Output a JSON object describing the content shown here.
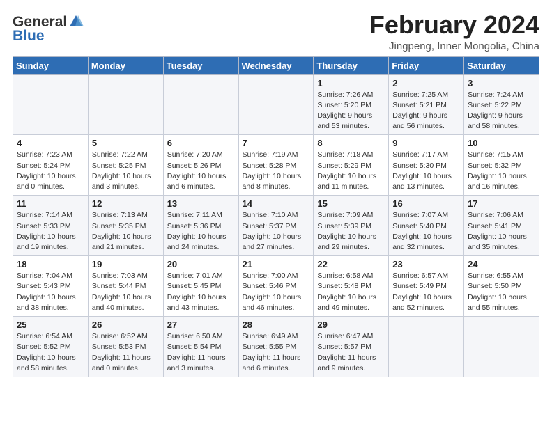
{
  "header": {
    "logo_general": "General",
    "logo_blue": "Blue",
    "month_title": "February 2024",
    "location": "Jingpeng, Inner Mongolia, China"
  },
  "weekdays": [
    "Sunday",
    "Monday",
    "Tuesday",
    "Wednesday",
    "Thursday",
    "Friday",
    "Saturday"
  ],
  "weeks": [
    [
      {
        "day": "",
        "info": ""
      },
      {
        "day": "",
        "info": ""
      },
      {
        "day": "",
        "info": ""
      },
      {
        "day": "",
        "info": ""
      },
      {
        "day": "1",
        "info": "Sunrise: 7:26 AM\nSunset: 5:20 PM\nDaylight: 9 hours\nand 53 minutes."
      },
      {
        "day": "2",
        "info": "Sunrise: 7:25 AM\nSunset: 5:21 PM\nDaylight: 9 hours\nand 56 minutes."
      },
      {
        "day": "3",
        "info": "Sunrise: 7:24 AM\nSunset: 5:22 PM\nDaylight: 9 hours\nand 58 minutes."
      }
    ],
    [
      {
        "day": "4",
        "info": "Sunrise: 7:23 AM\nSunset: 5:24 PM\nDaylight: 10 hours\nand 0 minutes."
      },
      {
        "day": "5",
        "info": "Sunrise: 7:22 AM\nSunset: 5:25 PM\nDaylight: 10 hours\nand 3 minutes."
      },
      {
        "day": "6",
        "info": "Sunrise: 7:20 AM\nSunset: 5:26 PM\nDaylight: 10 hours\nand 6 minutes."
      },
      {
        "day": "7",
        "info": "Sunrise: 7:19 AM\nSunset: 5:28 PM\nDaylight: 10 hours\nand 8 minutes."
      },
      {
        "day": "8",
        "info": "Sunrise: 7:18 AM\nSunset: 5:29 PM\nDaylight: 10 hours\nand 11 minutes."
      },
      {
        "day": "9",
        "info": "Sunrise: 7:17 AM\nSunset: 5:30 PM\nDaylight: 10 hours\nand 13 minutes."
      },
      {
        "day": "10",
        "info": "Sunrise: 7:15 AM\nSunset: 5:32 PM\nDaylight: 10 hours\nand 16 minutes."
      }
    ],
    [
      {
        "day": "11",
        "info": "Sunrise: 7:14 AM\nSunset: 5:33 PM\nDaylight: 10 hours\nand 19 minutes."
      },
      {
        "day": "12",
        "info": "Sunrise: 7:13 AM\nSunset: 5:35 PM\nDaylight: 10 hours\nand 21 minutes."
      },
      {
        "day": "13",
        "info": "Sunrise: 7:11 AM\nSunset: 5:36 PM\nDaylight: 10 hours\nand 24 minutes."
      },
      {
        "day": "14",
        "info": "Sunrise: 7:10 AM\nSunset: 5:37 PM\nDaylight: 10 hours\nand 27 minutes."
      },
      {
        "day": "15",
        "info": "Sunrise: 7:09 AM\nSunset: 5:39 PM\nDaylight: 10 hours\nand 29 minutes."
      },
      {
        "day": "16",
        "info": "Sunrise: 7:07 AM\nSunset: 5:40 PM\nDaylight: 10 hours\nand 32 minutes."
      },
      {
        "day": "17",
        "info": "Sunrise: 7:06 AM\nSunset: 5:41 PM\nDaylight: 10 hours\nand 35 minutes."
      }
    ],
    [
      {
        "day": "18",
        "info": "Sunrise: 7:04 AM\nSunset: 5:43 PM\nDaylight: 10 hours\nand 38 minutes."
      },
      {
        "day": "19",
        "info": "Sunrise: 7:03 AM\nSunset: 5:44 PM\nDaylight: 10 hours\nand 40 minutes."
      },
      {
        "day": "20",
        "info": "Sunrise: 7:01 AM\nSunset: 5:45 PM\nDaylight: 10 hours\nand 43 minutes."
      },
      {
        "day": "21",
        "info": "Sunrise: 7:00 AM\nSunset: 5:46 PM\nDaylight: 10 hours\nand 46 minutes."
      },
      {
        "day": "22",
        "info": "Sunrise: 6:58 AM\nSunset: 5:48 PM\nDaylight: 10 hours\nand 49 minutes."
      },
      {
        "day": "23",
        "info": "Sunrise: 6:57 AM\nSunset: 5:49 PM\nDaylight: 10 hours\nand 52 minutes."
      },
      {
        "day": "24",
        "info": "Sunrise: 6:55 AM\nSunset: 5:50 PM\nDaylight: 10 hours\nand 55 minutes."
      }
    ],
    [
      {
        "day": "25",
        "info": "Sunrise: 6:54 AM\nSunset: 5:52 PM\nDaylight: 10 hours\nand 58 minutes."
      },
      {
        "day": "26",
        "info": "Sunrise: 6:52 AM\nSunset: 5:53 PM\nDaylight: 11 hours\nand 0 minutes."
      },
      {
        "day": "27",
        "info": "Sunrise: 6:50 AM\nSunset: 5:54 PM\nDaylight: 11 hours\nand 3 minutes."
      },
      {
        "day": "28",
        "info": "Sunrise: 6:49 AM\nSunset: 5:55 PM\nDaylight: 11 hours\nand 6 minutes."
      },
      {
        "day": "29",
        "info": "Sunrise: 6:47 AM\nSunset: 5:57 PM\nDaylight: 11 hours\nand 9 minutes."
      },
      {
        "day": "",
        "info": ""
      },
      {
        "day": "",
        "info": ""
      }
    ]
  ]
}
